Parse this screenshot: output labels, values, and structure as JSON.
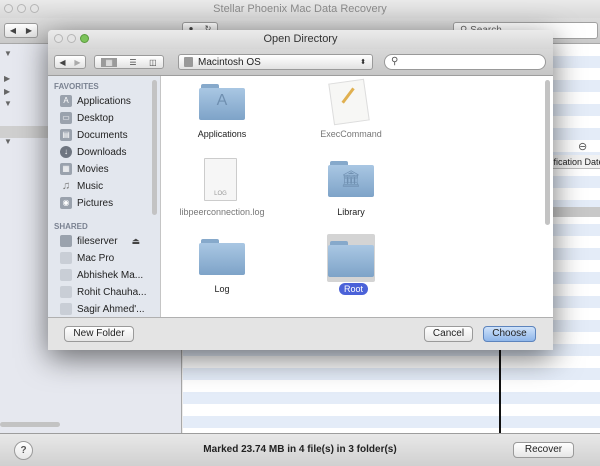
{
  "app": {
    "title": "Stellar Phoenix Mac Data Recovery",
    "search_placeholder": "Search",
    "column_header": "Modification Date",
    "status": "Marked 23.74 MB in 4 file(s) in 3 folder(s)",
    "recover_label": "Recover",
    "help_label": "?"
  },
  "dialog": {
    "title": "Open Directory",
    "location": "Macintosh OS",
    "search_value": "",
    "sidebar": {
      "favorites_heading": "FAVORITES",
      "favorites": [
        {
          "label": "Applications",
          "icon": "applications-icon"
        },
        {
          "label": "Desktop",
          "icon": "desktop-icon"
        },
        {
          "label": "Documents",
          "icon": "documents-icon"
        },
        {
          "label": "Downloads",
          "icon": "downloads-icon"
        },
        {
          "label": "Movies",
          "icon": "movies-icon"
        },
        {
          "label": "Music",
          "icon": "music-icon"
        },
        {
          "label": "Pictures",
          "icon": "pictures-icon"
        }
      ],
      "shared_heading": "SHARED",
      "shared": [
        {
          "label": "fileserver"
        },
        {
          "label": "Mac Pro"
        },
        {
          "label": "Abhishek Ma..."
        },
        {
          "label": "Rohit Chauha..."
        },
        {
          "label": "Sagir Ahmed'..."
        }
      ]
    },
    "items": [
      {
        "label": "Applications"
      },
      {
        "label": "ExecCommand"
      },
      {
        "label": "libpeerconnection.log",
        "file_tag": "LOG"
      },
      {
        "label": "Library"
      },
      {
        "label": "Log"
      },
      {
        "label": "Root"
      }
    ],
    "new_folder_label": "New Folder",
    "cancel_label": "Cancel",
    "choose_label": "Choose"
  }
}
